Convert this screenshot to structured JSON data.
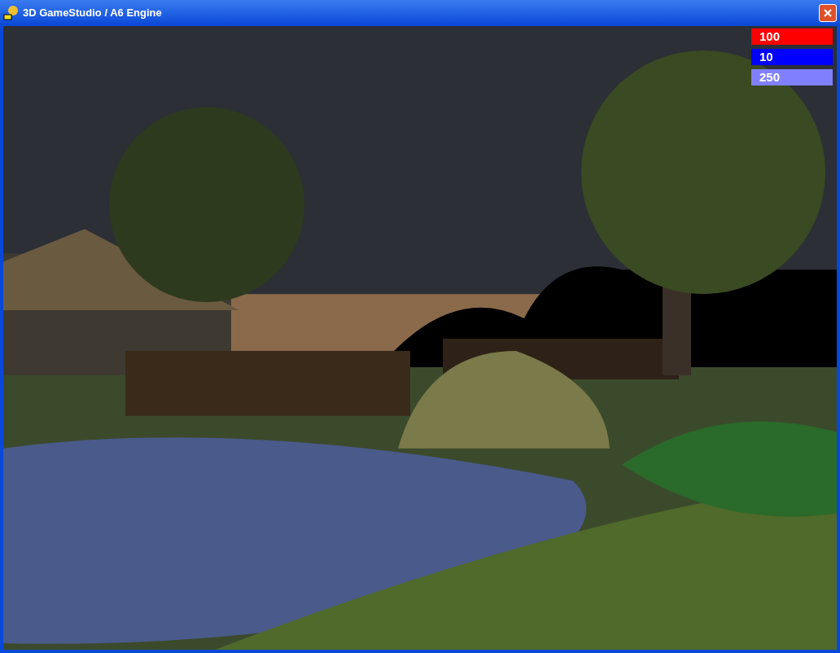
{
  "window": {
    "title": "3D GameStudio / A6 Engine"
  },
  "hud": [
    {
      "value": "100",
      "color": "#ff0000"
    },
    {
      "value": "10",
      "color": "#0000ff"
    },
    {
      "value": "250",
      "color": "#8080ff"
    }
  ]
}
